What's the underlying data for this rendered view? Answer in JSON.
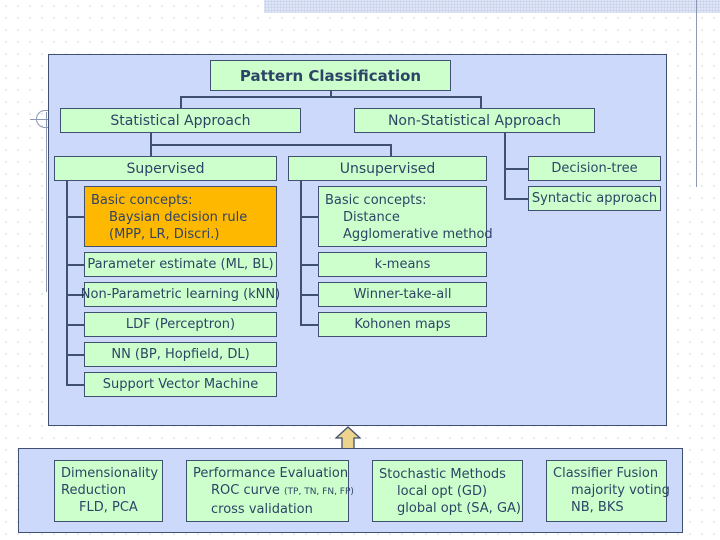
{
  "title": "Pattern Classification",
  "approaches": {
    "statistical": "Statistical Approach",
    "non_statistical": "Non-Statistical Approach"
  },
  "supervised": {
    "label": "Supervised",
    "basic": {
      "heading": "Basic concepts:",
      "line1": "Baysian decision rule",
      "line2": "(MPP, LR, Discri.)"
    },
    "items": [
      "Parameter estimate (ML, BL)",
      "Non-Parametric learning (kNN)",
      "LDF (Perceptron)",
      "NN (BP, Hopfield, DL)",
      "Support Vector Machine"
    ]
  },
  "unsupervised": {
    "label": "Unsupervised",
    "basic": {
      "heading": "Basic concepts:",
      "line1": "Distance",
      "line2": "Agglomerative method"
    },
    "items": [
      "k-means",
      "Winner-take-all",
      "Kohonen maps"
    ]
  },
  "non_statistical_items": [
    "Decision-tree",
    "Syntactic approach"
  ],
  "supporting": {
    "dimensionality": {
      "line1": "Dimensionality",
      "line2": "Reduction",
      "line3": "FLD, PCA"
    },
    "performance": {
      "line1": "Performance Evaluation",
      "line2": "ROC curve",
      "line2_small": "(TP, TN, FN, FP)",
      "line3": "cross validation"
    },
    "stochastic": {
      "line1": "Stochastic Methods",
      "line2": "local opt (GD)",
      "line3": "global opt (SA, GA)"
    },
    "fusion": {
      "line1": "Classifier Fusion",
      "line2": "majority voting",
      "line3": "NB, BKS"
    }
  },
  "colors": {
    "panel": "#ccd9fa",
    "box": "#ccffcc",
    "highlight": "#ffb800",
    "border": "#3f5070",
    "arrow": "#ecd48c"
  }
}
